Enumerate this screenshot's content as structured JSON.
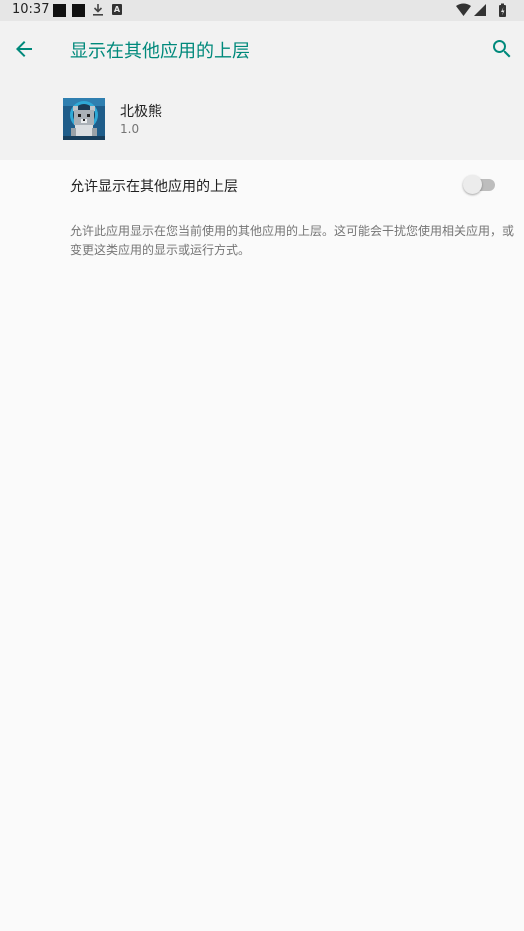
{
  "status_bar": {
    "time": "10:37",
    "notification_icons": [
      "black-square-icon",
      "black-square-icon",
      "download-icon",
      "a-letter-icon"
    ],
    "a_icon_letter": "A",
    "system_icons": [
      "wifi-icon",
      "cellular-signal-icon",
      "battery-icon"
    ]
  },
  "app_bar": {
    "title": "显示在其他应用的上层",
    "back_icon": "arrow-back-icon",
    "search_icon": "search-icon",
    "accent_color": "#00897b"
  },
  "app_header": {
    "name": "北极熊",
    "version": "1.0",
    "icon": "polar-bear-app-icon"
  },
  "preference": {
    "label": "允许显示在其他应用的上层",
    "enabled": false,
    "summary": "允许此应用显示在您当前使用的其他应用的上层。这可能会干扰您使用相关应用，或变更这类应用的显示或运行方式。"
  }
}
